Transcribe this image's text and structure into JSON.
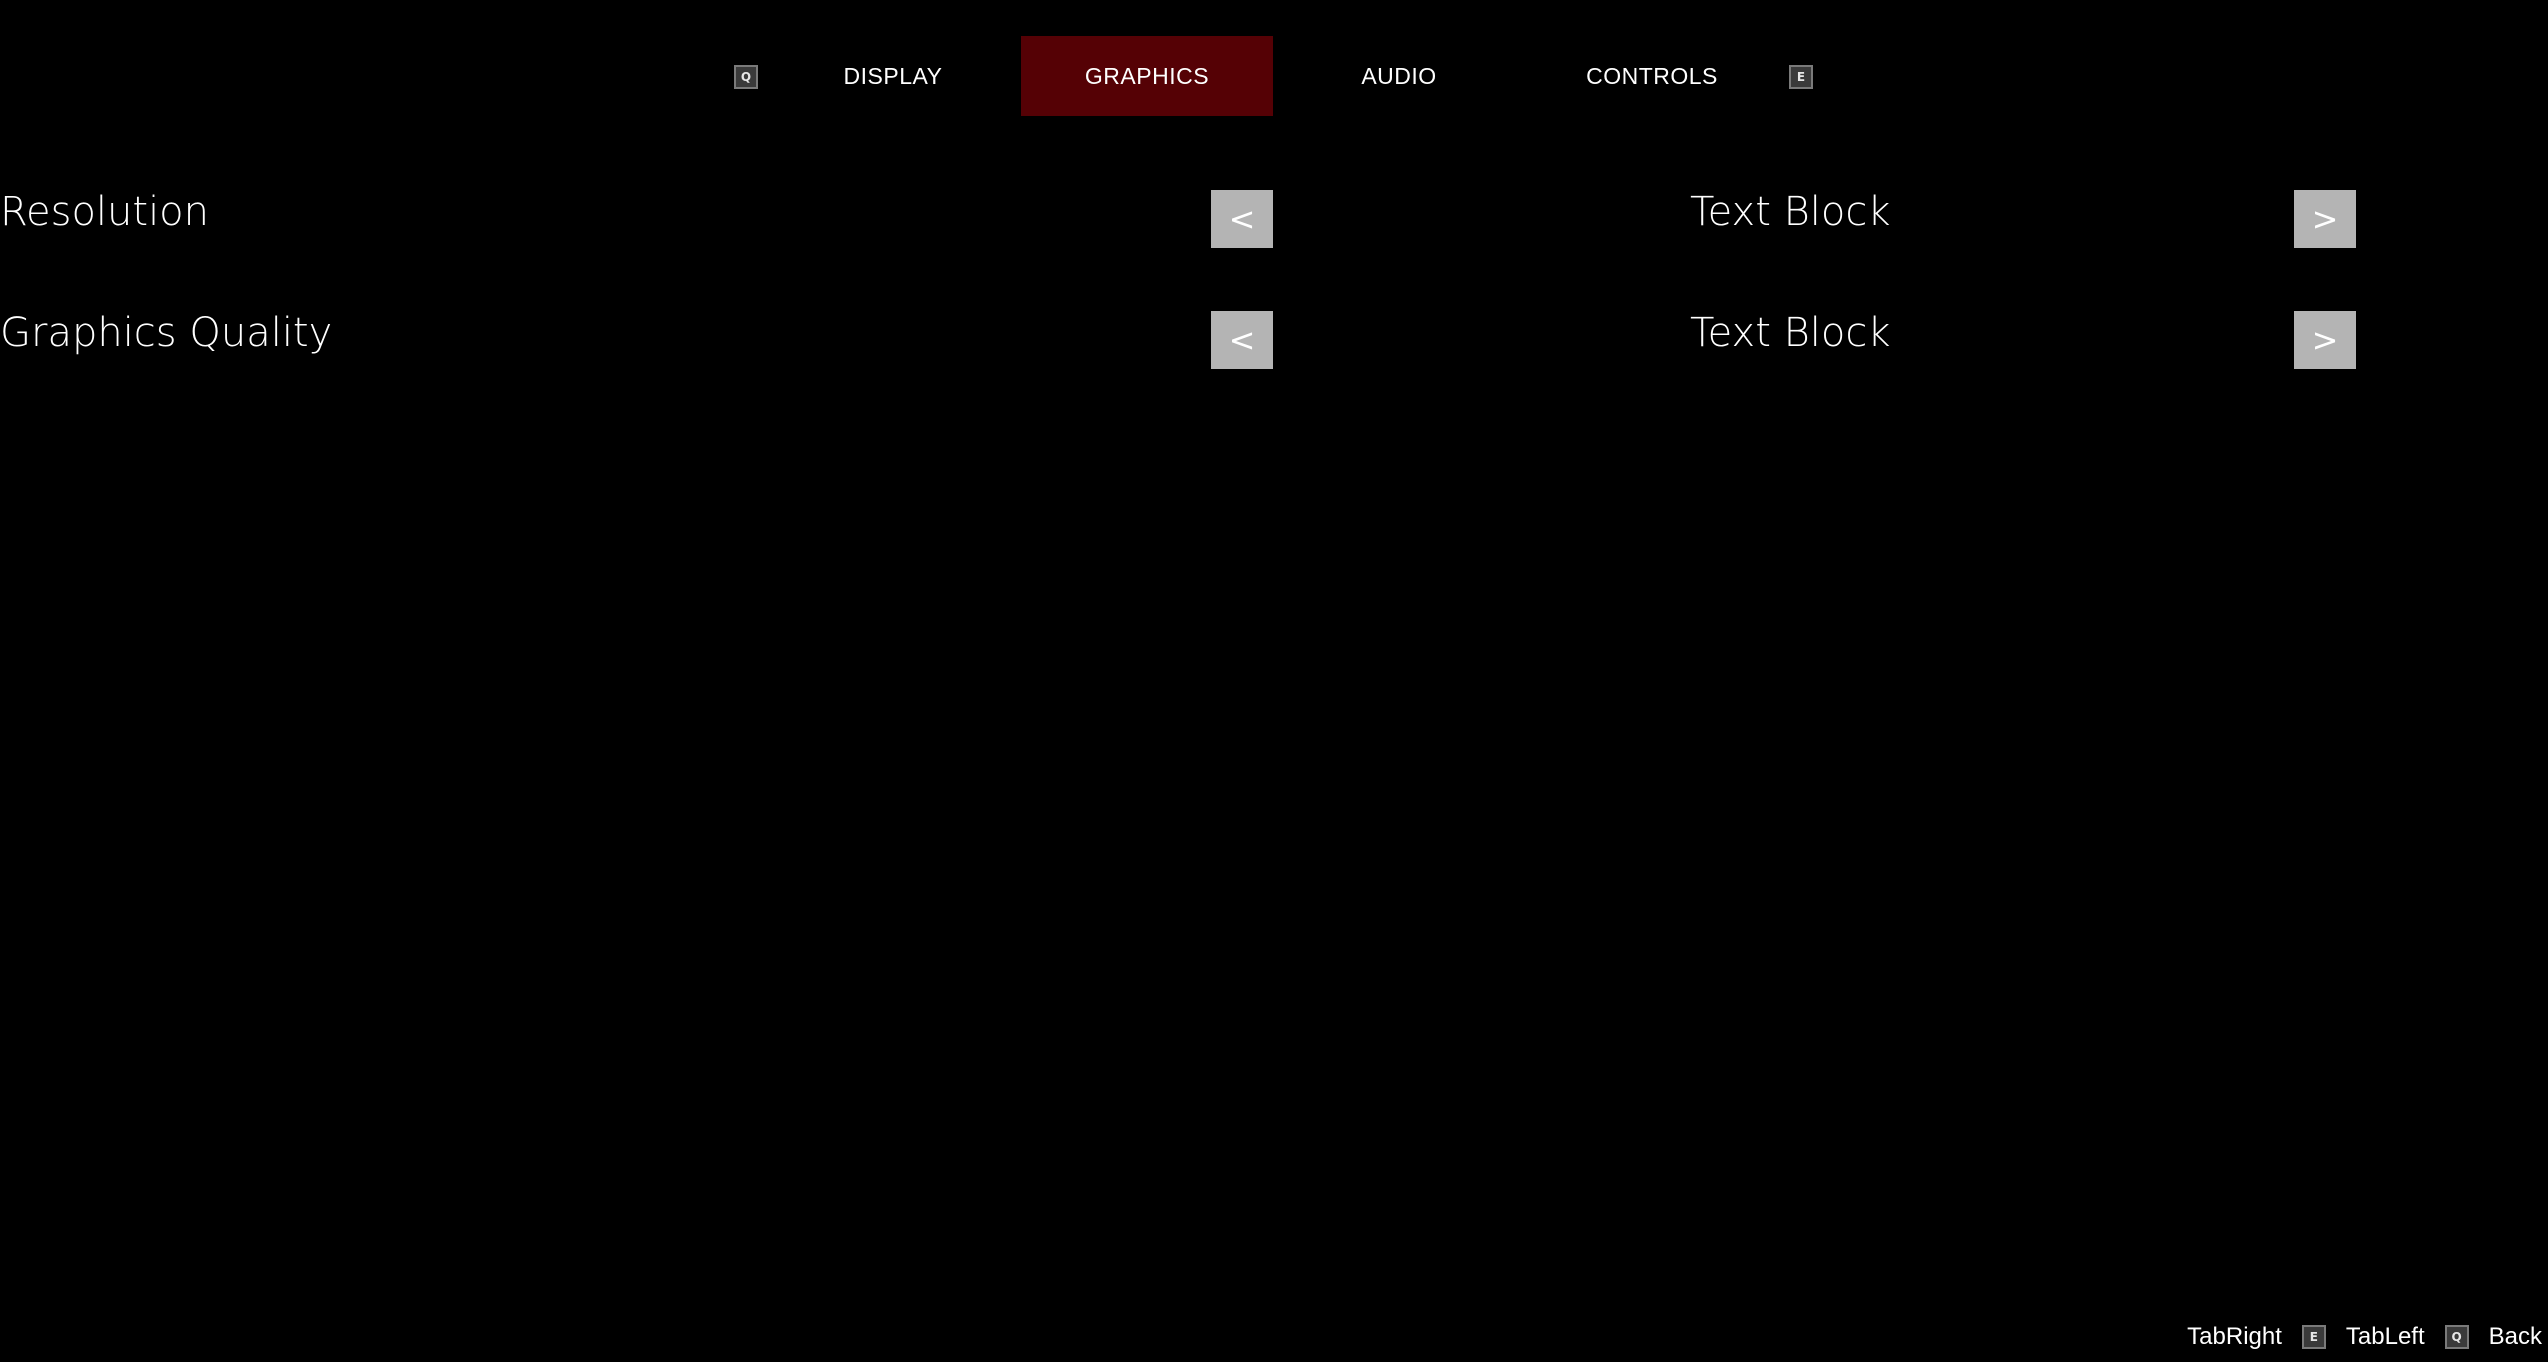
{
  "tab_bar": {
    "prev_key": "Q",
    "next_key": "E",
    "tabs": [
      {
        "label": "DISPLAY",
        "active": false
      },
      {
        "label": "GRAPHICS",
        "active": true
      },
      {
        "label": "AUDIO",
        "active": false
      },
      {
        "label": "CONTROLS",
        "active": false
      }
    ]
  },
  "settings": [
    {
      "label": "Resolution",
      "prev_button": "<",
      "value": "Text Block",
      "next_button": ">"
    },
    {
      "label": "Graphics Quality",
      "prev_button": "<",
      "value": "Text Block",
      "next_button": ">"
    }
  ],
  "footer": {
    "tab_right_label": "TabRight",
    "tab_right_key": "E",
    "tab_left_label": "TabLeft",
    "tab_left_key": "Q",
    "back_label": "Back"
  },
  "colors": {
    "background": "#000000",
    "active_tab": "#550105",
    "arrow_button": "#b4b4b4",
    "text": "#ffffff"
  }
}
